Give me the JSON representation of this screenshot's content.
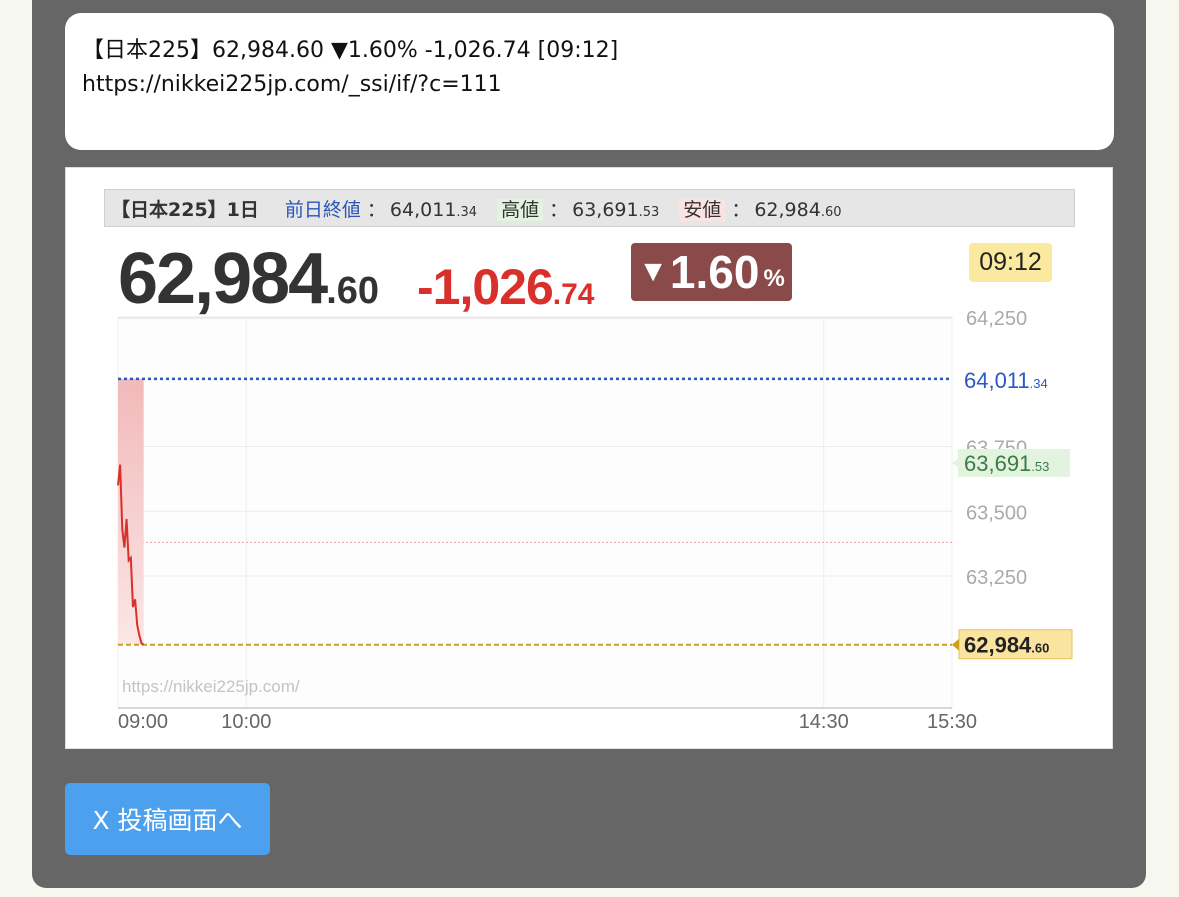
{
  "post_text": {
    "line1": "【日本225】62,984.60 ▼1.60% -1,026.74 [09:12]",
    "line2": "https://nikkei225jp.com/_ssi/if/?c=111"
  },
  "widget": {
    "tag": "【日本225】1日",
    "prev_close_label": "前日終値",
    "prev_close_main": "64,011",
    "prev_close_dec": ".34",
    "high_label": "高値",
    "high_main": "63,691",
    "high_dec": ".53",
    "low_label": "安値",
    "low_main": "62,984",
    "low_dec": ".60",
    "colon": "：",
    "price_main": "62,984",
    "price_dec": ".60",
    "change_main": "-1,026",
    "change_dec": ".74",
    "pct_arrow": "▼",
    "pct_main": "1.60",
    "pct_unit": "%",
    "time": "09:12",
    "watermark": "https://nikkei225jp.com/"
  },
  "chart_data": {
    "type": "line",
    "x_ticks": [
      "09:00",
      "10:00",
      "14:30",
      "15:30"
    ],
    "y_ticks": [
      "64,250",
      "63,750",
      "63,500",
      "63,250"
    ],
    "ylim": [
      62750,
      64350
    ],
    "xlim_minutes": [
      0,
      390
    ],
    "series": [
      {
        "x_minutes": [
          0,
          1,
          2,
          3,
          4,
          5,
          6,
          7,
          8,
          9,
          10,
          11,
          12
        ],
        "values": [
          63600,
          63680,
          63430,
          63360,
          63470,
          63310,
          63320,
          63130,
          63160,
          63060,
          63020,
          62990,
          62984.6
        ]
      }
    ],
    "reference_lines": [
      {
        "label_main": "64,011",
        "label_dec": ".34",
        "value": 64011.34,
        "style": "dotted",
        "color": "#2c57c7"
      },
      {
        "label_main": "63,691",
        "label_dec": ".53",
        "value": 63691.53,
        "style": "marker",
        "color": "#3d7a45"
      },
      {
        "label_main": "62,984",
        "label_dec": ".60",
        "value": 62984.6,
        "style": "dashed",
        "color": "#c9a21a"
      }
    ],
    "minor_line_value": 63380,
    "colors": {
      "line": "#d9302b",
      "fill": "#f5c4c4",
      "grid": "#ebebeb",
      "axis_text": "#aaaaaa"
    }
  },
  "button": {
    "label": "X 投稿画面へ"
  }
}
